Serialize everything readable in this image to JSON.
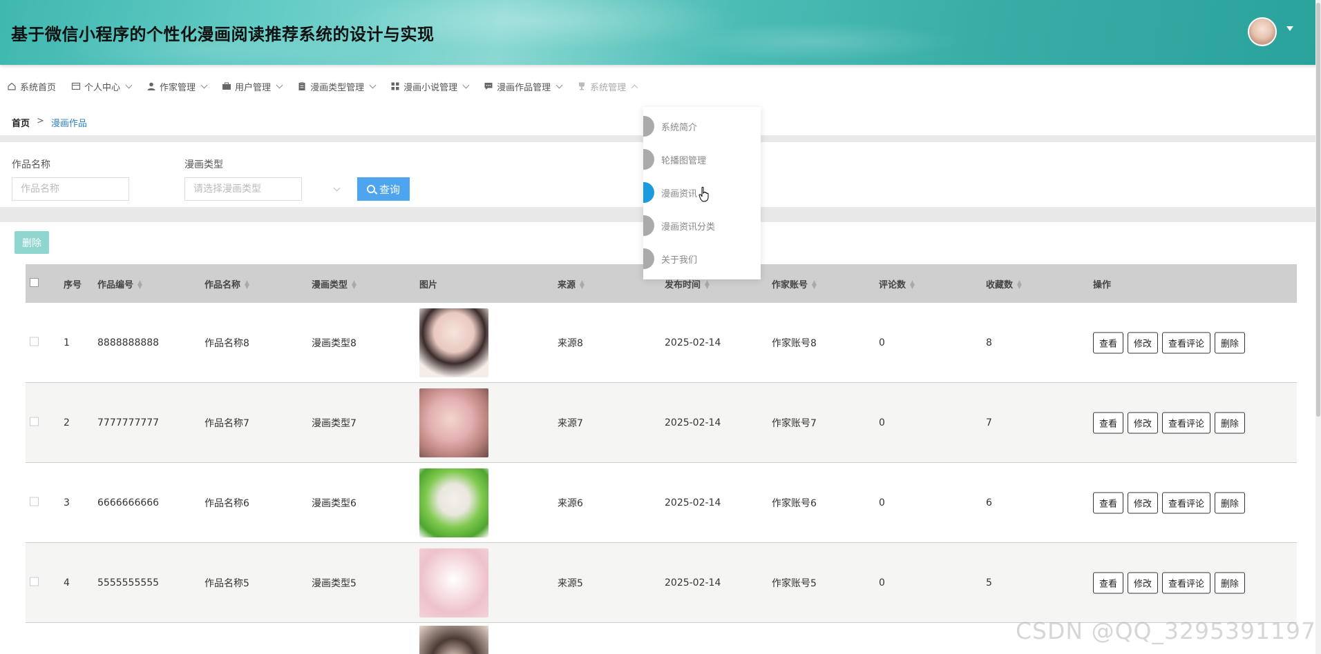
{
  "app": {
    "title": "基于微信小程序的个性化漫画阅读推荐系统的设计与实现"
  },
  "nav": {
    "items": [
      {
        "label": "系统首页",
        "icon": "home-icon",
        "has_caret": false
      },
      {
        "label": "个人中心",
        "icon": "id-card-icon",
        "has_caret": true
      },
      {
        "label": "作家管理",
        "icon": "user-icon",
        "has_caret": true
      },
      {
        "label": "用户管理",
        "icon": "briefcase-icon",
        "has_caret": true
      },
      {
        "label": "漫画类型管理",
        "icon": "clipboard-icon",
        "has_caret": true
      },
      {
        "label": "漫画小说管理",
        "icon": "grid-icon",
        "has_caret": true
      },
      {
        "label": "漫画作品管理",
        "icon": "comment-icon",
        "has_caret": true
      },
      {
        "label": "系统管理",
        "icon": "trophy-icon",
        "has_caret": true,
        "open": true
      }
    ]
  },
  "dropdown": {
    "items": [
      {
        "label": "系统简介",
        "active": false
      },
      {
        "label": "轮播图管理",
        "active": false
      },
      {
        "label": "漫画资讯",
        "active": true
      },
      {
        "label": "漫画资讯分类",
        "active": false
      },
      {
        "label": "关于我们",
        "active": false
      }
    ]
  },
  "breadcrumb": {
    "home": "首页",
    "separator": ">",
    "current": "漫画作品"
  },
  "search": {
    "name_label": "作品名称",
    "name_placeholder": "作品名称",
    "type_label": "漫画类型",
    "type_placeholder": "请选择漫画类型",
    "query_label": "查询"
  },
  "toolbar": {
    "delete_label": "删除"
  },
  "table": {
    "columns": [
      "序号",
      "作品编号",
      "作品名称",
      "漫画类型",
      "图片",
      "来源",
      "发布时间",
      "作家账号",
      "评论数",
      "收藏数",
      "操作"
    ],
    "actions": [
      "查看",
      "修改",
      "查看评论",
      "删除"
    ],
    "rows": [
      {
        "index": "1",
        "code": "8888888888",
        "name": "作品名称8",
        "type": "漫画类型8",
        "source": "来源8",
        "date": "2025-02-14",
        "author": "作家账号8",
        "comments": "0",
        "favorites": "8"
      },
      {
        "index": "2",
        "code": "7777777777",
        "name": "作品名称7",
        "type": "漫画类型7",
        "source": "来源7",
        "date": "2025-02-14",
        "author": "作家账号7",
        "comments": "0",
        "favorites": "7"
      },
      {
        "index": "3",
        "code": "6666666666",
        "name": "作品名称6",
        "type": "漫画类型6",
        "source": "来源6",
        "date": "2025-02-14",
        "author": "作家账号6",
        "comments": "0",
        "favorites": "6"
      },
      {
        "index": "4",
        "code": "5555555555",
        "name": "作品名称5",
        "type": "漫画类型5",
        "source": "来源5",
        "date": "2025-02-14",
        "author": "作家账号5",
        "comments": "0",
        "favorites": "5"
      }
    ]
  },
  "watermark": "CSDN @QQ_3295391197",
  "colors": {
    "header": "#3fb8b0",
    "accent": "#4ea5ef",
    "delete_button": "#8ed6cf",
    "breadcrumb_current": "#2d7fbf",
    "dropdown_active": "#1b9bdd"
  }
}
